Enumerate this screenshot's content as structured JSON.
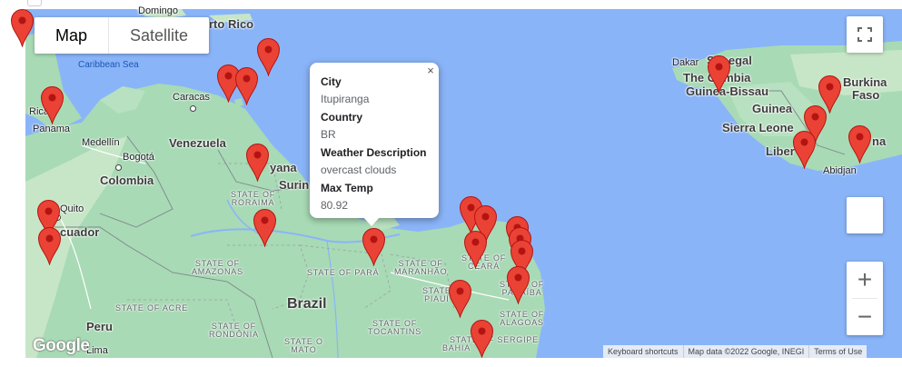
{
  "map_type_control": {
    "map_label": "Map",
    "satellite_label": "Satellite",
    "selected": "Map"
  },
  "info_window": {
    "close_glyph": "×",
    "fields": [
      {
        "label": "City",
        "value": "Itupiranga"
      },
      {
        "label": "Country",
        "value": "BR"
      },
      {
        "label": "Weather Description",
        "value": "overcast clouds"
      },
      {
        "label": "Max Temp",
        "value": "80.92"
      }
    ]
  },
  "zoom": {
    "in_label": "+",
    "out_label": "−"
  },
  "icons": {
    "fullscreen": "fullscreen-icon",
    "pegman": "pegman-icon",
    "marker": "map-pin-icon"
  },
  "attribution": {
    "logo": "Google",
    "keyboard_shortcuts": "Keyboard shortcuts",
    "map_data": "Map data ©2022 Google, INEGI",
    "terms": "Terms of Use"
  },
  "map_labels": {
    "domingo": "Domingo",
    "puerto_rico": "rto Rico",
    "caribbean_sea": "Caribbean Sea",
    "caracas": "Caracas",
    "venezuela": "Venezuela",
    "medellin": "Medellín",
    "bogota": "Bogotá",
    "colombia": "Colombia",
    "quito": "Quito",
    "ecuador": "cuador",
    "panama": "Panama",
    "rica": "Rica",
    "guyana": "yana",
    "suriname": "Surin",
    "state_roraima": "STATE OF\nRORAIMA",
    "state_amazonas": "STATE OF\nAMAZONAS",
    "state_para": "STATE OF PARÁ",
    "state_maranhao": "STATE OF\nMARANHÃO",
    "state_ceara": "STATE OF\nCEARÁ",
    "state_piaui": "STATE\nPIAUÍ",
    "state_paraiba": "STATE OF\nPARAÍBA",
    "state_alagoas": "STATE OF\nALAGOAS",
    "state_sergipe": "STATE OF SERGIPE",
    "state_tocantins": "STATE OF\nTOCANTINS",
    "state_bahia": "BAHIA",
    "state_acre": "STATE OF ACRE",
    "state_rondonia": "STATE OF\nRONDÔNIA",
    "state_mato": "STATE O\nMATO",
    "brazil": "Brazil",
    "peru": "Peru",
    "lima": "Lima",
    "dakar": "Dakar",
    "senegal": "Senegal",
    "gambia": "The Gambia",
    "guinea_bissau": "Guinea-Bissau",
    "guinea": "Guinea",
    "burkina": "Burkina",
    "faso": "Faso",
    "sierra_leone": "Sierra Leone",
    "liberia": "Liber",
    "abidjan": "Abidjan",
    "ghana": "na"
  },
  "markers": [
    {
      "name": "marker-1"
    },
    {
      "name": "marker-2"
    },
    {
      "name": "marker-3"
    },
    {
      "name": "marker-4"
    },
    {
      "name": "marker-5"
    },
    {
      "name": "marker-6"
    },
    {
      "name": "marker-7"
    },
    {
      "name": "marker-8"
    },
    {
      "name": "marker-9"
    },
    {
      "name": "marker-10"
    },
    {
      "name": "marker-11"
    },
    {
      "name": "marker-12"
    },
    {
      "name": "marker-13"
    },
    {
      "name": "marker-14"
    },
    {
      "name": "marker-15"
    },
    {
      "name": "marker-16"
    },
    {
      "name": "marker-17"
    },
    {
      "name": "marker-18"
    },
    {
      "name": "marker-19"
    },
    {
      "name": "marker-20"
    },
    {
      "name": "marker-21"
    },
    {
      "name": "marker-22"
    },
    {
      "name": "marker-23"
    },
    {
      "name": "marker-24"
    },
    {
      "name": "marker-25"
    },
    {
      "name": "marker-26"
    }
  ],
  "colors": {
    "water": "#8ab4f8",
    "land": "#a8dab5",
    "marker": "#ea4335"
  }
}
